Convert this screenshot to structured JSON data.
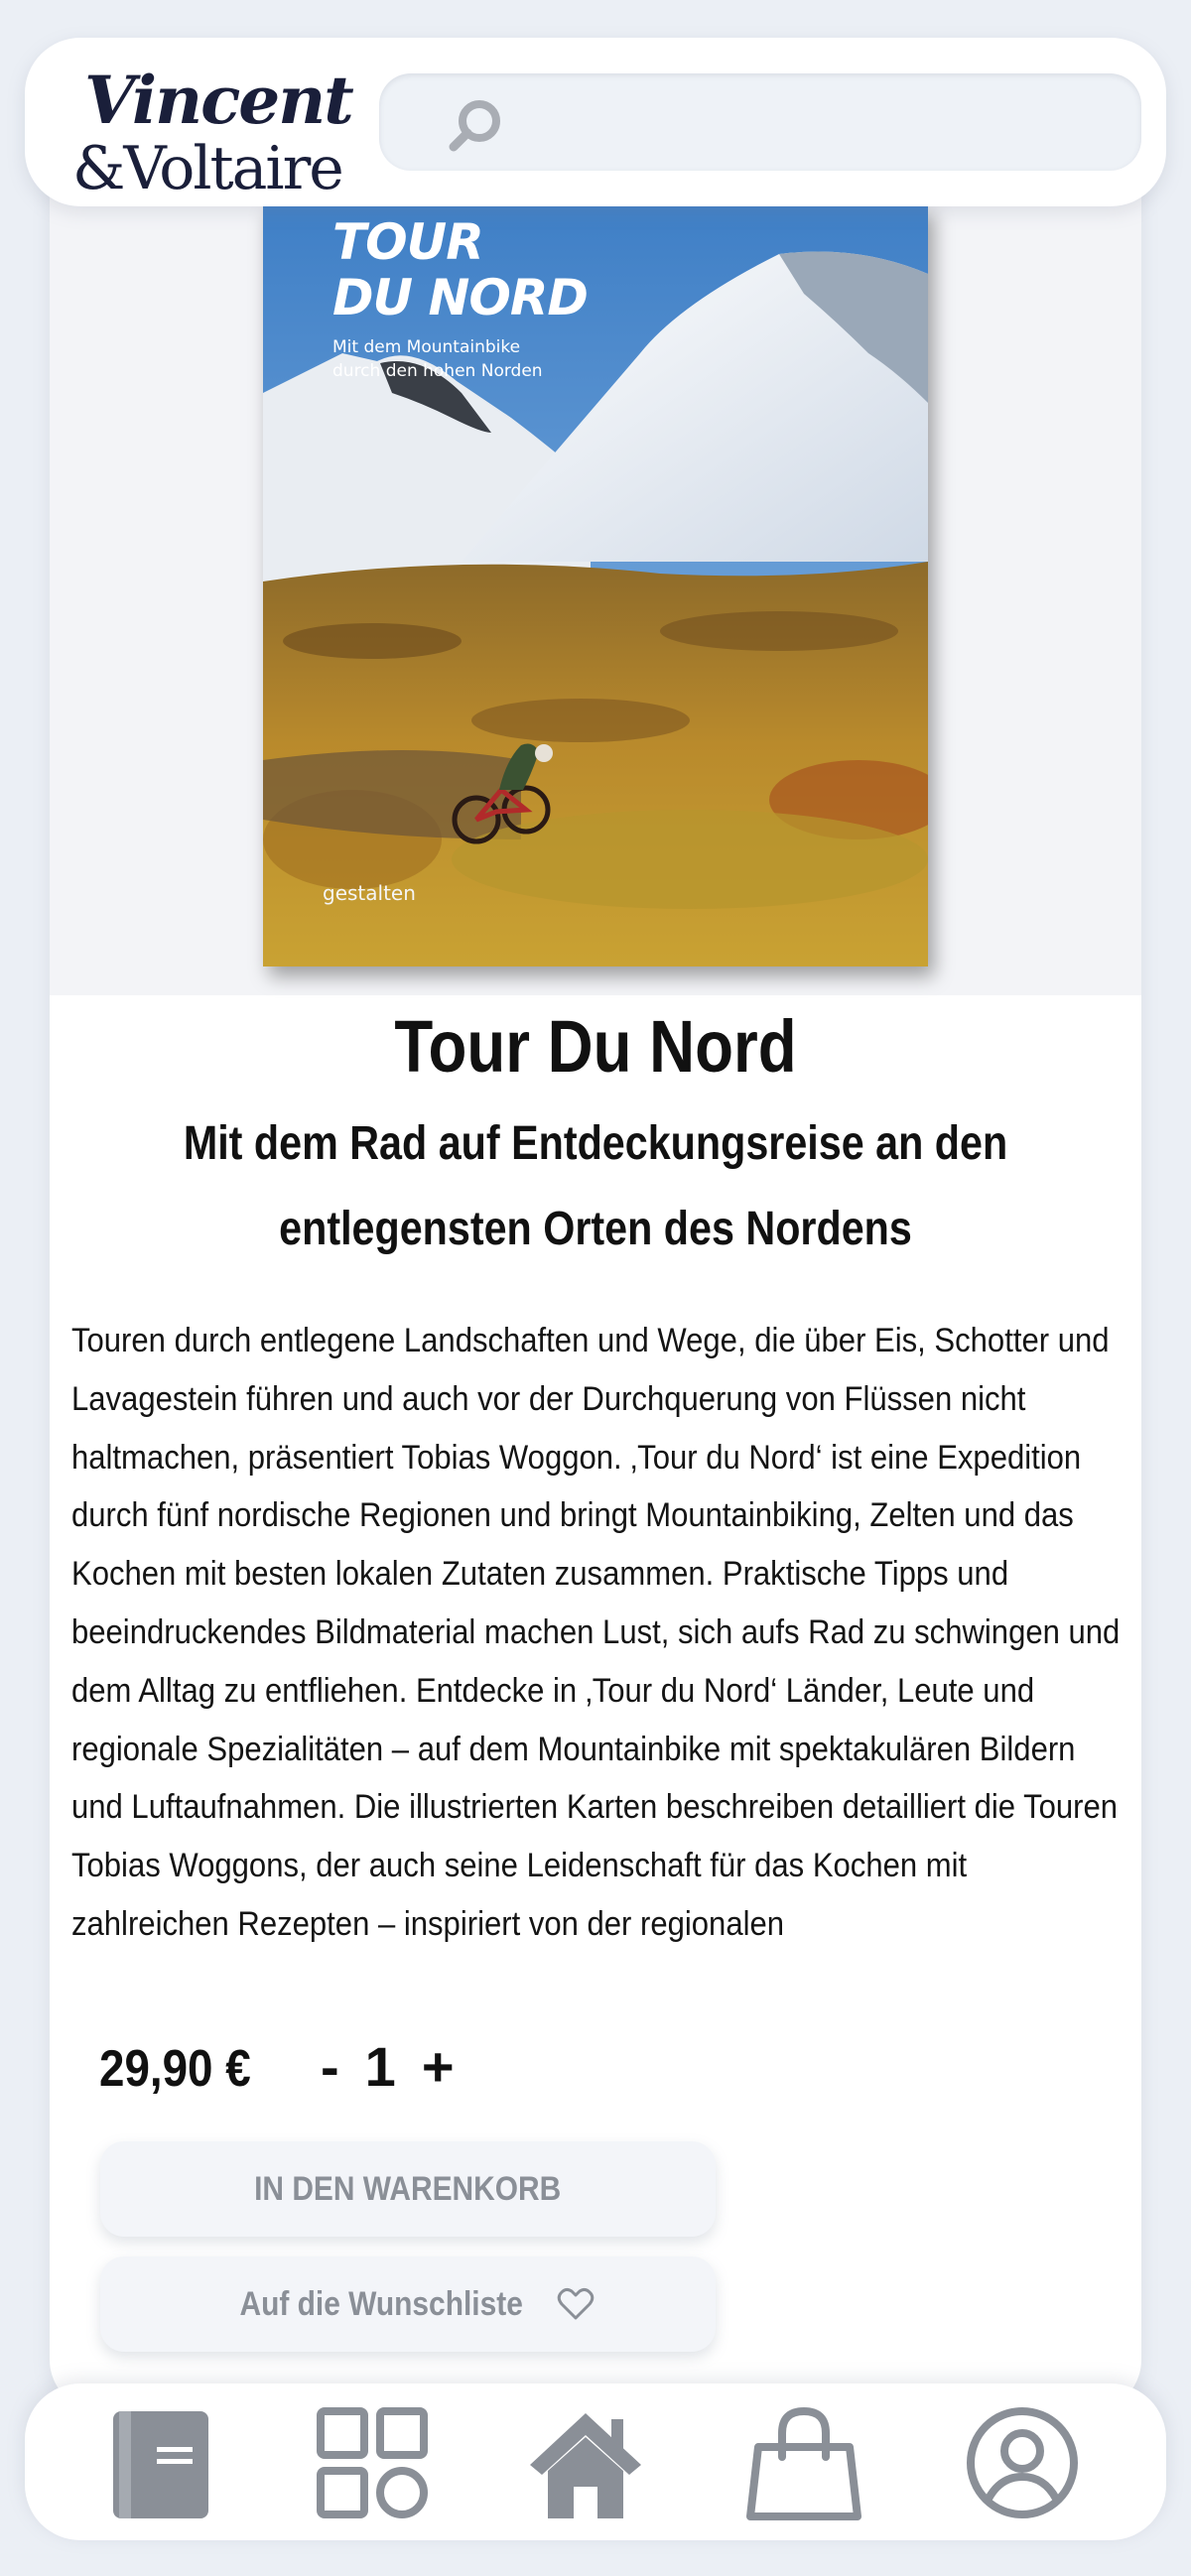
{
  "brand": {
    "logo_line1": "Vincent",
    "logo_line2": "&Voltaire"
  },
  "search": {
    "placeholder": "",
    "icon": "search-icon"
  },
  "product": {
    "cover": {
      "title_line1": "TOUR",
      "title_line2": "DU NORD",
      "subtitle_line1": "Mit dem Mountainbike",
      "subtitle_line2": "durch den hohen Norden",
      "publisher": "gestalten"
    },
    "title": "Tour Du Nord",
    "subtitle": "Mit dem Rad auf Entdeckungsreise an den entlegensten Orten des Nordens",
    "description": "Touren durch entlegene Landschaften und Wege, die über Eis, Schotter und Lavagestein führen und auch vor der Durchquerung von Flüssen nicht haltmachen, präsentiert Tobias Woggon. ‚Tour du Nord‘ ist eine Expedition durch fünf nordische Regionen und bringt Mountainbiking, Zelten und das Kochen mit besten lokalen Zutaten zusammen. Praktische Tipps und beeindruckendes Bildmaterial machen Lust, sich aufs Rad zu schwingen und dem Alltag zu entfliehen. Entdecke in ‚Tour du Nord‘ Länder, Leute und regionale Spezialitäten – auf dem Mountainbike mit spektakulären Bildern und Luftaufnahmen. Die illustrierten Karten beschreiben detailliert die Touren Tobias Woggons, der auch seine Leidenschaft für das Kochen mit zahlreichen Rezepten – inspiriert von der regionalen",
    "price": "29,90 €",
    "quantity": {
      "minus": "-",
      "value": "1",
      "plus": "+"
    },
    "cart_button": "IN DEN WARENKORB",
    "wishlist_button": "Auf die Wunschliste"
  },
  "bottom_nav": [
    {
      "icon": "book-icon"
    },
    {
      "icon": "categories-icon"
    },
    {
      "icon": "home-icon"
    },
    {
      "icon": "shopping-bag-icon"
    },
    {
      "icon": "profile-icon"
    }
  ],
  "colors": {
    "background": "#ebeff5",
    "surface": "#ffffff",
    "icon_gray": "#8a8f97",
    "button_text": "#8a8f97",
    "text": "#111111"
  }
}
